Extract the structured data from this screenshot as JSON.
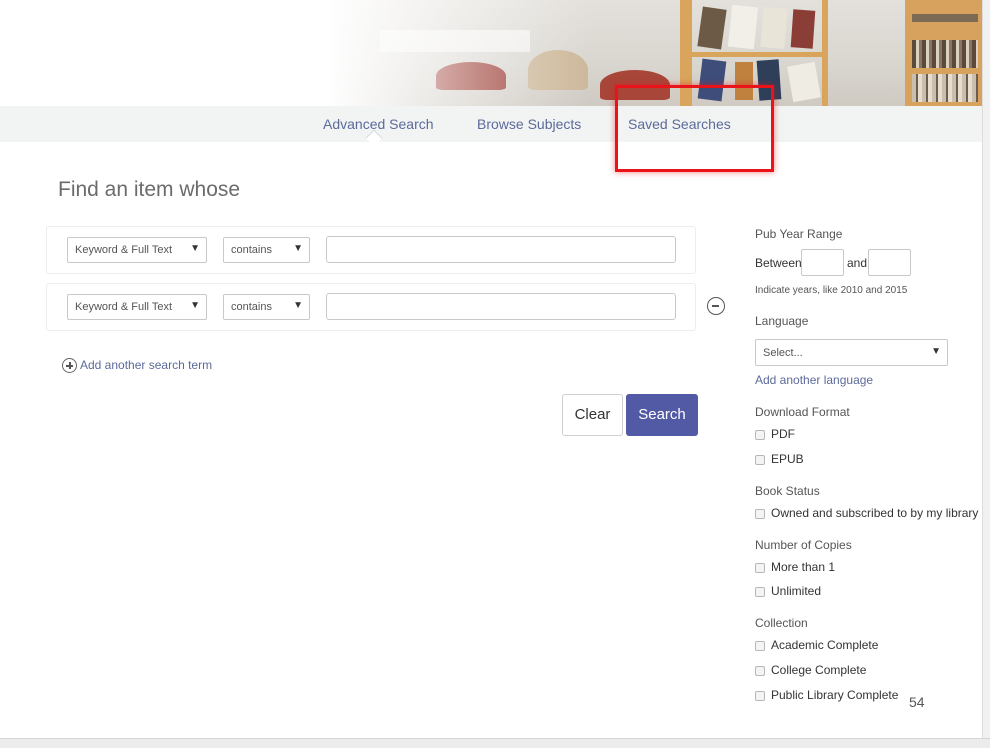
{
  "nav": {
    "advanced_search": "Advanced Search",
    "browse_subjects": "Browse Subjects",
    "saved_searches": "Saved Searches"
  },
  "heading": "Find an item whose",
  "search_rows": [
    {
      "field": "Keyword & Full Text",
      "operator": "contains",
      "value": ""
    },
    {
      "field": "Keyword & Full Text",
      "operator": "contains",
      "value": ""
    }
  ],
  "add_term_label": "Add another search term",
  "buttons": {
    "clear": "Clear",
    "search": "Search"
  },
  "filters": {
    "pub_year": {
      "title": "Pub Year Range",
      "between": "Between",
      "and": "and",
      "from": "",
      "to": "",
      "hint": "Indicate years, like 2010 and 2015"
    },
    "language": {
      "title": "Language",
      "selected": "Select...",
      "add_link": "Add another language"
    },
    "download_format": {
      "title": "Download Format",
      "options": [
        {
          "label": "PDF",
          "checked": false
        },
        {
          "label": "EPUB",
          "checked": false
        }
      ]
    },
    "book_status": {
      "title": "Book Status",
      "options": [
        {
          "label": "Owned and subscribed to by my library",
          "checked": false
        }
      ]
    },
    "copies": {
      "title": "Number of Copies",
      "options": [
        {
          "label": "More than 1",
          "checked": false
        },
        {
          "label": "Unlimited",
          "checked": false
        }
      ]
    },
    "collection": {
      "title": "Collection",
      "options": [
        {
          "label": "Academic Complete",
          "checked": false
        },
        {
          "label": "College Complete",
          "checked": false
        },
        {
          "label": "Public Library Complete",
          "checked": false
        }
      ]
    }
  },
  "page_number": "54",
  "colors": {
    "accent": "#535aa5",
    "link": "#5c6a9a",
    "highlight": "#e8141a"
  }
}
